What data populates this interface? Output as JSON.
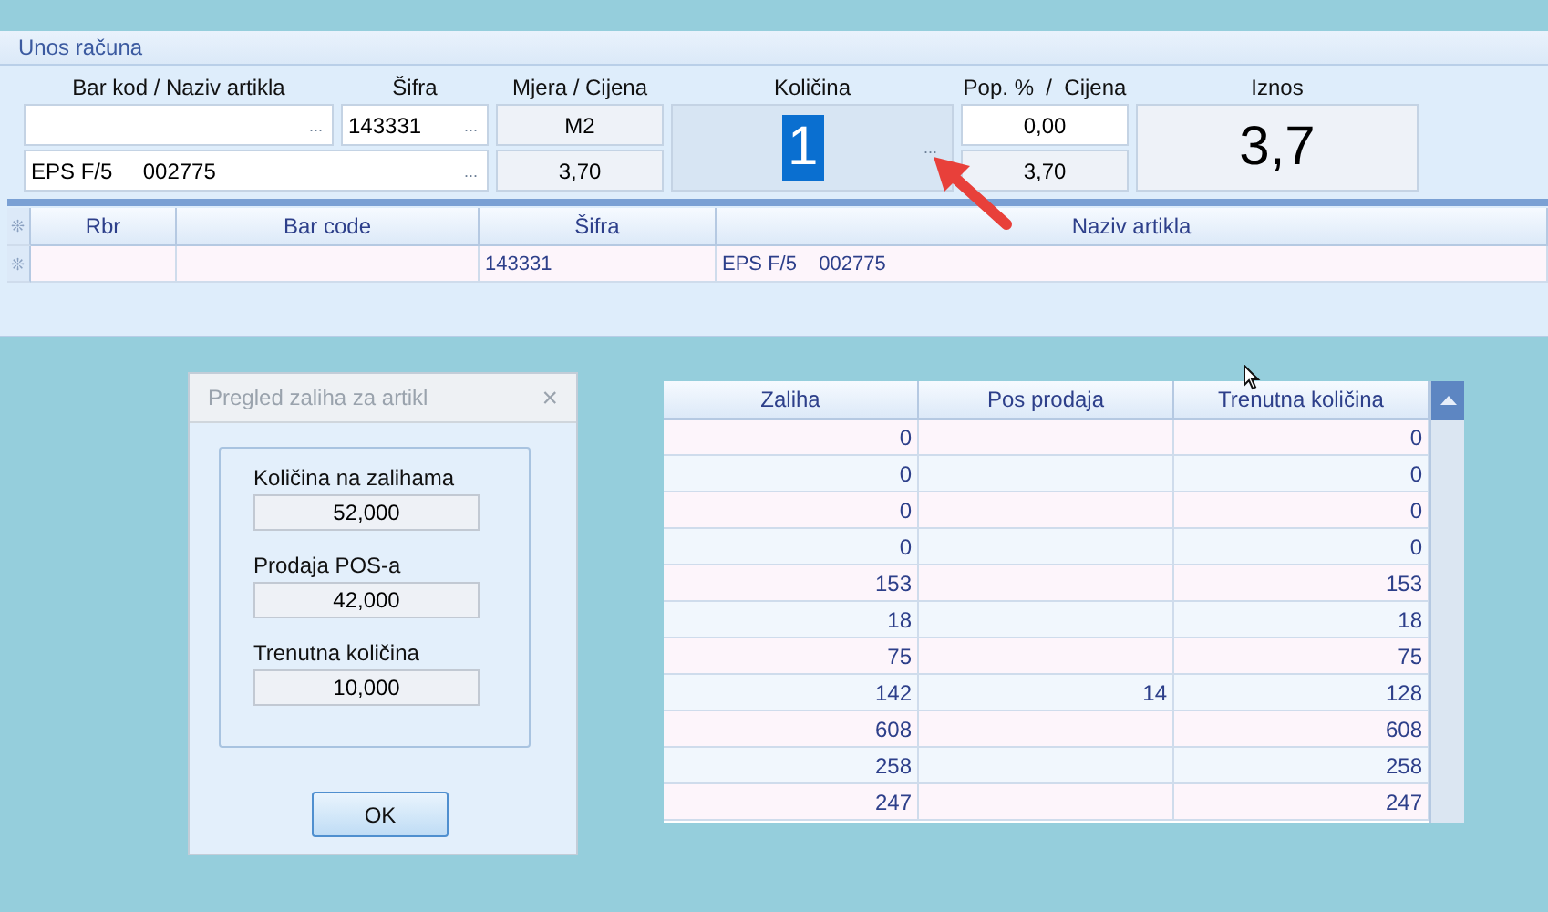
{
  "panel": {
    "title": "Unos računa",
    "labels": [
      "Bar kod / Naziv artikla",
      "Šifra",
      "Mjera / Cijena",
      "Količina",
      "Pop. %  /  Cijena",
      "Iznos"
    ],
    "barcode_field": {
      "button": "..."
    },
    "code_field": {
      "value": "143331",
      "button": "..."
    },
    "unit": "M2",
    "name_field": {
      "value": "EPS F/5     002775",
      "button": "..."
    },
    "price": "3,70",
    "quantity": {
      "value": "1",
      "selected": true,
      "button": "..."
    },
    "discount_field": {
      "value": "0,00"
    },
    "net_price": "3,70",
    "amount": "3,7"
  },
  "items_table": {
    "marker": "❊",
    "columns": [
      "Rbr",
      "Bar code",
      "Šifra",
      "Naziv artikla"
    ],
    "rows": [
      {
        "marker": "❊",
        "cells": [
          null,
          null,
          "143331",
          "EPS F/5    002775"
        ]
      }
    ]
  },
  "dialog": {
    "title": "Pregled zaliha za artikl",
    "close": "×",
    "fields": [
      {
        "label": "Količina na zalihama",
        "value": "52,000"
      },
      {
        "label": "Prodaja POS-a",
        "value": "42,000"
      },
      {
        "label": "Trenutna količina",
        "value": "10,000"
      }
    ],
    "button": "OK"
  },
  "stock_table": {
    "columns": [
      "Zaliha",
      "Pos prodaja",
      "Trenutna količina"
    ],
    "rows": [
      [
        "0",
        null,
        "0"
      ],
      [
        "0",
        null,
        "0"
      ],
      [
        "0",
        null,
        "0"
      ],
      [
        "0",
        null,
        "0"
      ],
      [
        "153",
        null,
        "153"
      ],
      [
        "18",
        null,
        "18"
      ],
      [
        "75",
        null,
        "75"
      ],
      [
        "142",
        "14",
        "128"
      ],
      [
        "608",
        null,
        "608"
      ],
      [
        "258",
        null,
        "258"
      ],
      [
        "247",
        null,
        "247"
      ]
    ]
  }
}
